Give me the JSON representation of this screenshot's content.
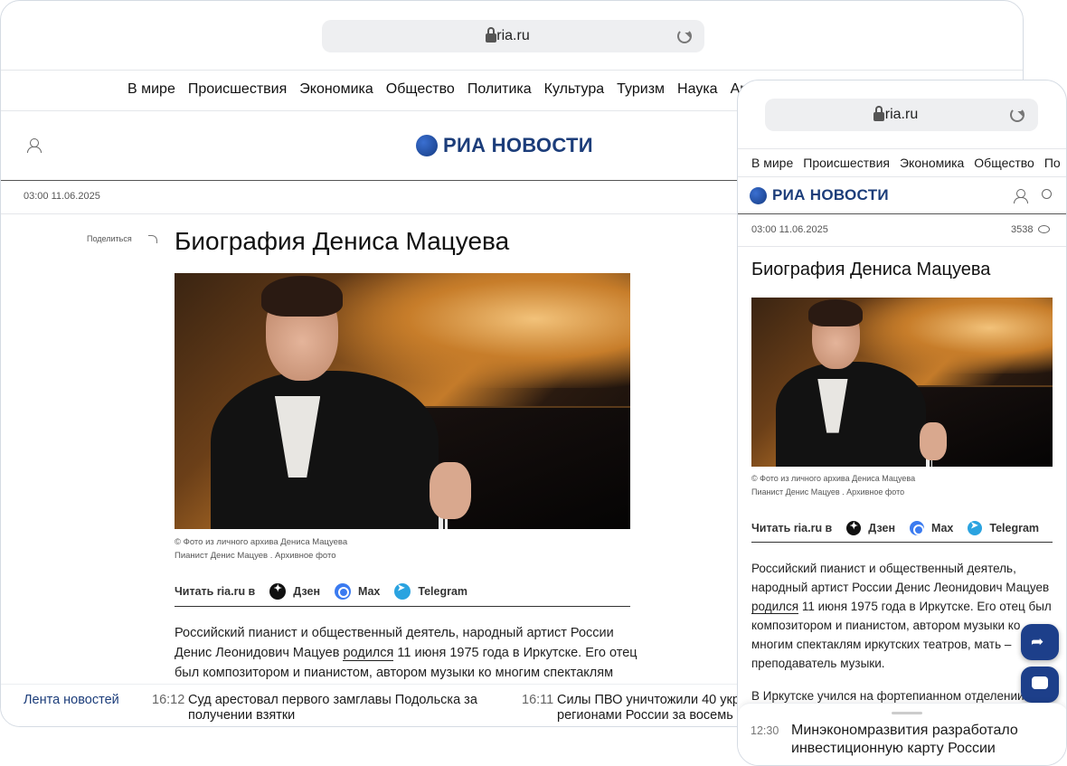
{
  "desktop": {
    "url": "ria.ru",
    "nav": [
      "В мире",
      "Происшествия",
      "Экономика",
      "Общество",
      "Политика",
      "Культура",
      "Туризм",
      "Наука",
      "Ар"
    ],
    "logo_text": "РИА НОВОСТИ",
    "date": "03:00 11.06.2025",
    "share_label": "Поделиться",
    "title": "Биография Дениса Мацуева",
    "caption1": "© Фото из личного архива Дениса Мацуева",
    "caption2": "Пианист Денис Мацуев . Архивное фото",
    "read_label": "Читать ria.ru в",
    "channels": [
      "Дзен",
      "Max",
      "Telegram"
    ],
    "para1": "Российский пианист и общественный деятель, народный артист России",
    "para2a": "Денис Леонидович Мацуев ",
    "para2link": "родился",
    "para2b": " 11 июня 1975 года в Иркутске. Его отец",
    "para3": "был композитором и пианистом, автором музыки ко многим спектаклям",
    "ticker_label": "Лента новостей",
    "ticker": [
      {
        "time": "16:12",
        "text1": "Суд арестовал первого замглавы Подольска за",
        "text2": "получении взятки"
      },
      {
        "time": "16:11",
        "text1": "Силы ПВО уничтожили 40 укр",
        "text2": "регионами России за восемь"
      }
    ]
  },
  "mobile": {
    "url": "ria.ru",
    "nav": [
      "В мире",
      "Происшествия",
      "Экономика",
      "Общество",
      "По"
    ],
    "logo_text": "РИА НОВОСТИ",
    "date": "03:00 11.06.2025",
    "views": "3538",
    "title": "Биография Дениса Мацуева",
    "caption1": "© Фото из личного архива Дениса Мацуева",
    "caption2": "Пианист Денис Мацуев . Архивное фото",
    "read_label": "Читать ria.ru в",
    "channels": [
      "Дзен",
      "Max",
      "Telegram"
    ],
    "lines": [
      "Российский пианист и общественный деятель,",
      "народный артист России Денис Леонидович Мацуев",
      "11 июня 1975 года в Иркутске. Его отец был",
      "композитором и пианистом, автором музыки ко",
      "многим спектаклям иркутских театров, мать –",
      "преподаватель музыки.",
      "В Иркутске учился на фортепианном отделении"
    ],
    "link": "родился",
    "ticker": {
      "time": "12:30",
      "text1": "Минэкономразвития разработало",
      "text2": "инвестиционную карту России"
    }
  }
}
